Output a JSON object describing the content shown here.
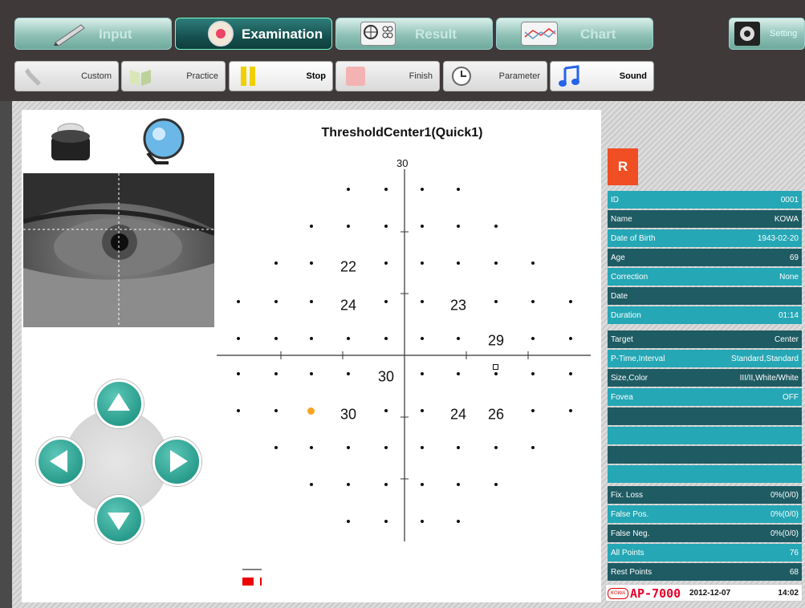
{
  "main_tabs": [
    {
      "label": "Input"
    },
    {
      "label": "Examination"
    },
    {
      "label": "Result"
    },
    {
      "label": "Chart"
    }
  ],
  "setting_label": "Setting",
  "sub_buttons": [
    {
      "label": "Custom"
    },
    {
      "label": "Practice"
    },
    {
      "label": "Stop"
    },
    {
      "label": "Finish"
    },
    {
      "label": "Parameter"
    },
    {
      "label": "Sound"
    }
  ],
  "exam_title": "ThresholdCenter1(Quick1)",
  "axis_top_label": "30",
  "thresholds": [
    {
      "label": "22"
    },
    {
      "label": "24"
    },
    {
      "label": "23"
    },
    {
      "label": "29"
    },
    {
      "label": "30"
    },
    {
      "label": "30"
    },
    {
      "label": "24"
    },
    {
      "label": "26"
    }
  ],
  "eye": "R",
  "patient": [
    {
      "k": "ID",
      "v": "0001"
    },
    {
      "k": "Name",
      "v": "KOWA"
    },
    {
      "k": "Date of Birth",
      "v": "1943-02-20"
    },
    {
      "k": "Age",
      "v": "69"
    },
    {
      "k": "Correction",
      "v": "None"
    },
    {
      "k": "Date",
      "v": ""
    },
    {
      "k": "Duration",
      "v": "01:14"
    }
  ],
  "test": [
    {
      "k": "Target",
      "v": "Center"
    },
    {
      "k": "P-Time,Interval",
      "v": "Standard,Standard"
    },
    {
      "k": "Size,Color",
      "v": "III/II,White/White"
    },
    {
      "k": "Fovea",
      "v": "OFF"
    }
  ],
  "reliability": [
    {
      "k": "Fix. Loss",
      "v": "0%(0/0)"
    },
    {
      "k": "False Pos.",
      "v": "0%(0/0)"
    },
    {
      "k": "False Neg.",
      "v": "0%(0/0)"
    },
    {
      "k": "All Points",
      "v": "76"
    },
    {
      "k": "Rest Points",
      "v": "68"
    }
  ],
  "footer": {
    "brand_small": "KOWA",
    "model": "AP-7000",
    "date": "2012-12-07",
    "time": "14:02"
  },
  "colors": {
    "accent": "#25a7b5",
    "dark": "#1e5b63",
    "eye_badge": "#f04e23",
    "stimulus": "#f5a623"
  }
}
